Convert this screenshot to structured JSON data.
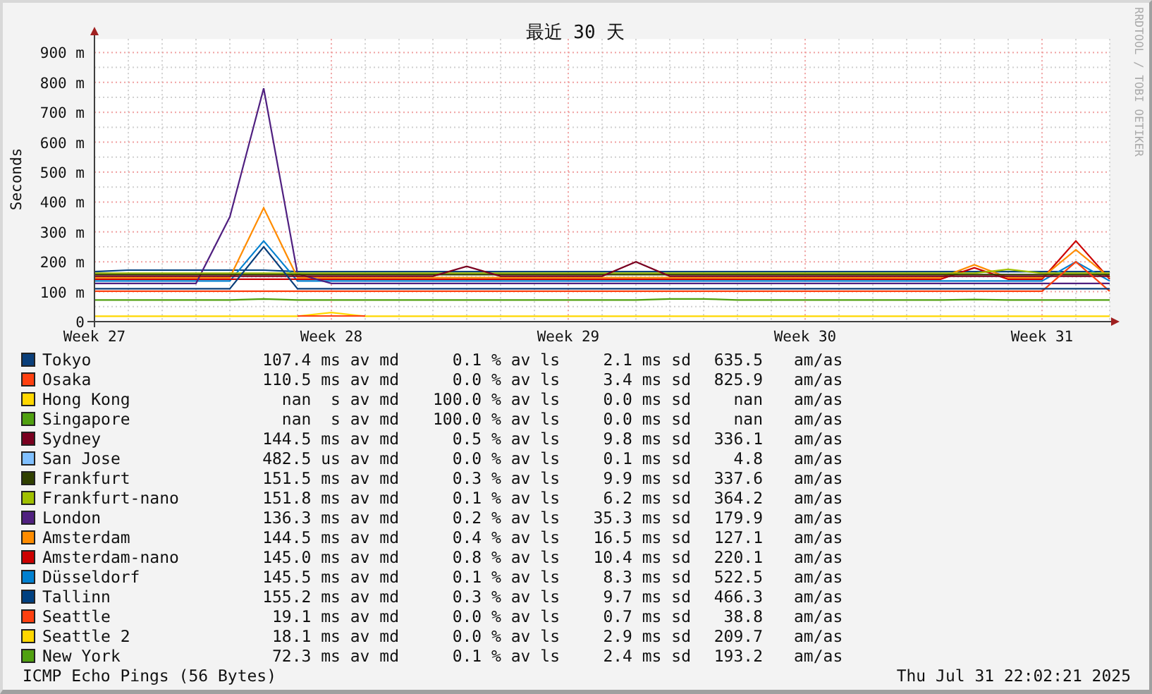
{
  "chart": {
    "vertical_credit": "RRDTOOL / TOBI OETIKER",
    "chart_data": {
      "type": "line",
      "title": "最近 30 天",
      "ylabel": "Seconds",
      "ylim": [
        0,
        945
      ],
      "grid": true,
      "yticks": [
        {
          "value": 0,
          "label": "0"
        },
        {
          "value": 100,
          "label": "100 m"
        },
        {
          "value": 200,
          "label": "200 m"
        },
        {
          "value": 300,
          "label": "300 m"
        },
        {
          "value": 400,
          "label": "400 m"
        },
        {
          "value": 500,
          "label": "500 m"
        },
        {
          "value": 600,
          "label": "600 m"
        },
        {
          "value": 700,
          "label": "700 m"
        },
        {
          "value": 800,
          "label": "800 m"
        },
        {
          "value": 900,
          "label": "900 m"
        }
      ],
      "categories": [
        "Week 27",
        null,
        null,
        null,
        null,
        null,
        null,
        "Week 28",
        null,
        null,
        null,
        null,
        null,
        null,
        "Week 29",
        null,
        null,
        null,
        null,
        null,
        null,
        "Week 30",
        null,
        null,
        null,
        null,
        null,
        null,
        "Week 31",
        null,
        null
      ],
      "series": [
        {
          "name": "Tokyo",
          "color": "#0a3f7a",
          "values": [
            110,
            110,
            110,
            110,
            110,
            250,
            110,
            110,
            110,
            110,
            110,
            110,
            110,
            110,
            110,
            110,
            110,
            110,
            110,
            110,
            110,
            110,
            110,
            110,
            110,
            110,
            110,
            110,
            110,
            110,
            110
          ]
        },
        {
          "name": "Osaka",
          "color": "#ff4010",
          "values": [
            102,
            102,
            102,
            102,
            102,
            102,
            102,
            102,
            102,
            102,
            102,
            102,
            102,
            102,
            102,
            102,
            102,
            102,
            102,
            102,
            102,
            102,
            102,
            102,
            102,
            102,
            102,
            102,
            102,
            200,
            102
          ]
        },
        {
          "name": "Hong Kong",
          "color": "#ffd700",
          "values": [
            null,
            null,
            null,
            null,
            null,
            null,
            null,
            null,
            null,
            null,
            null,
            null,
            null,
            null,
            null,
            null,
            null,
            null,
            null,
            null,
            null,
            null,
            null,
            null,
            null,
            null,
            null,
            null,
            null,
            null,
            null
          ]
        },
        {
          "name": "Singapore",
          "color": "#50a010",
          "values": [
            null,
            null,
            null,
            null,
            null,
            null,
            null,
            null,
            null,
            null,
            null,
            null,
            null,
            null,
            null,
            null,
            null,
            null,
            null,
            null,
            null,
            null,
            null,
            null,
            null,
            null,
            null,
            null,
            null,
            null,
            null
          ]
        },
        {
          "name": "Sydney",
          "color": "#7a0020",
          "values": [
            152,
            152,
            152,
            152,
            152,
            152,
            152,
            152,
            152,
            152,
            152,
            185,
            152,
            152,
            152,
            152,
            200,
            152,
            152,
            152,
            152,
            152,
            152,
            152,
            152,
            152,
            152,
            152,
            152,
            152,
            152
          ]
        },
        {
          "name": "San Jose",
          "color": "#80c0ff",
          "values": [
            null,
            null,
            null,
            null,
            null,
            null,
            null,
            null,
            null,
            null,
            null,
            null,
            null,
            null,
            null,
            null,
            null,
            null,
            null,
            null,
            null,
            null,
            null,
            null,
            null,
            null,
            null,
            null,
            null,
            null,
            null
          ]
        },
        {
          "name": "Frankfurt",
          "color": "#304000",
          "values": [
            157,
            157,
            157,
            157,
            157,
            157,
            157,
            157,
            157,
            157,
            157,
            157,
            157,
            157,
            157,
            157,
            157,
            157,
            157,
            157,
            157,
            157,
            157,
            157,
            157,
            157,
            157,
            157,
            157,
            157,
            157
          ]
        },
        {
          "name": "Frankfurt-nano",
          "color": "#a0c000",
          "values": [
            162,
            162,
            162,
            162,
            162,
            162,
            162,
            162,
            162,
            162,
            162,
            162,
            162,
            162,
            162,
            162,
            162,
            162,
            162,
            162,
            162,
            162,
            162,
            162,
            162,
            162,
            162,
            175,
            162,
            162,
            162
          ]
        },
        {
          "name": "London",
          "color": "#502080",
          "values": [
            128,
            128,
            128,
            128,
            350,
            780,
            160,
            128,
            128,
            128,
            128,
            128,
            128,
            128,
            128,
            128,
            128,
            128,
            128,
            128,
            128,
            128,
            128,
            128,
            128,
            128,
            128,
            128,
            128,
            128,
            128
          ]
        },
        {
          "name": "Amsterdam",
          "color": "#ff8c00",
          "values": [
            147,
            147,
            147,
            147,
            147,
            380,
            147,
            147,
            147,
            147,
            147,
            147,
            147,
            147,
            147,
            147,
            147,
            147,
            147,
            147,
            147,
            147,
            147,
            147,
            147,
            147,
            190,
            147,
            147,
            240,
            147
          ]
        },
        {
          "name": "Amsterdam-nano",
          "color": "#cc0000",
          "values": [
            142,
            142,
            142,
            142,
            142,
            142,
            142,
            142,
            142,
            142,
            142,
            142,
            142,
            142,
            142,
            142,
            142,
            142,
            142,
            142,
            142,
            142,
            142,
            142,
            142,
            142,
            180,
            142,
            142,
            270,
            142
          ]
        },
        {
          "name": "Düsseldorf",
          "color": "#0080d0",
          "values": [
            136,
            136,
            136,
            136,
            136,
            270,
            136,
            136,
            136,
            136,
            136,
            136,
            136,
            136,
            136,
            136,
            136,
            136,
            136,
            136,
            136,
            136,
            136,
            136,
            136,
            136,
            136,
            136,
            136,
            200,
            136
          ]
        },
        {
          "name": "Tallinn",
          "color": "#004080",
          "values": [
            167,
            172,
            172,
            172,
            172,
            172,
            167,
            167,
            167,
            167,
            167,
            167,
            167,
            167,
            167,
            167,
            167,
            167,
            167,
            167,
            167,
            167,
            167,
            167,
            167,
            167,
            167,
            167,
            167,
            167,
            167
          ]
        },
        {
          "name": "Seattle",
          "color": "#ff4010",
          "values": [
            null,
            null,
            null,
            null,
            null,
            null,
            19,
            19,
            19,
            null,
            null,
            null,
            null,
            null,
            null,
            null,
            null,
            null,
            null,
            null,
            null,
            null,
            null,
            null,
            null,
            null,
            null,
            null,
            null,
            null,
            null
          ]
        },
        {
          "name": "Seattle 2",
          "color": "#ffd700",
          "values": [
            18,
            18,
            18,
            18,
            18,
            18,
            18,
            30,
            18,
            18,
            18,
            18,
            18,
            18,
            18,
            18,
            18,
            18,
            18,
            18,
            18,
            18,
            18,
            18,
            18,
            18,
            18,
            18,
            18,
            18,
            18
          ]
        },
        {
          "name": "New York",
          "color": "#50a010",
          "values": [
            72,
            72,
            72,
            72,
            72,
            76,
            72,
            72,
            72,
            72,
            72,
            72,
            72,
            72,
            72,
            72,
            72,
            76,
            76,
            72,
            72,
            72,
            72,
            72,
            72,
            72,
            74,
            72,
            72,
            72,
            72
          ]
        }
      ]
    }
  },
  "legend": [
    {
      "median": "107.4 ms av md",
      "loss": "0.1 % av ls",
      "sd": "2.1 ms sd",
      "ratio": "635.5",
      "unit": "am/as"
    },
    {
      "median": "110.5 ms av md",
      "loss": "0.0 % av ls",
      "sd": "3.4 ms sd",
      "ratio": "825.9",
      "unit": "am/as"
    },
    {
      "median": "nan  s av md",
      "loss": "100.0 % av ls",
      "sd": "0.0 ms sd",
      "ratio": "nan",
      "unit": "am/as"
    },
    {
      "median": "nan  s av md",
      "loss": "100.0 % av ls",
      "sd": "0.0 ms sd",
      "ratio": "nan",
      "unit": "am/as"
    },
    {
      "median": "144.5 ms av md",
      "loss": "0.5 % av ls",
      "sd": "9.8 ms sd",
      "ratio": "336.1",
      "unit": "am/as"
    },
    {
      "median": "482.5 us av md",
      "loss": "0.0 % av ls",
      "sd": "0.1 ms sd",
      "ratio": "4.8",
      "unit": "am/as"
    },
    {
      "median": "151.5 ms av md",
      "loss": "0.3 % av ls",
      "sd": "9.9 ms sd",
      "ratio": "337.6",
      "unit": "am/as"
    },
    {
      "median": "151.8 ms av md",
      "loss": "0.1 % av ls",
      "sd": "6.2 ms sd",
      "ratio": "364.2",
      "unit": "am/as"
    },
    {
      "median": "136.3 ms av md",
      "loss": "0.2 % av ls",
      "sd": "35.3 ms sd",
      "ratio": "179.9",
      "unit": "am/as"
    },
    {
      "median": "144.5 ms av md",
      "loss": "0.4 % av ls",
      "sd": "16.5 ms sd",
      "ratio": "127.1",
      "unit": "am/as"
    },
    {
      "median": "145.0 ms av md",
      "loss": "0.8 % av ls",
      "sd": "10.4 ms sd",
      "ratio": "220.1",
      "unit": "am/as"
    },
    {
      "median": "145.5 ms av md",
      "loss": "0.1 % av ls",
      "sd": "8.3 ms sd",
      "ratio": "522.5",
      "unit": "am/as"
    },
    {
      "median": "155.2 ms av md",
      "loss": "0.3 % av ls",
      "sd": "9.7 ms sd",
      "ratio": "466.3",
      "unit": "am/as"
    },
    {
      "median": "19.1 ms av md",
      "loss": "0.0 % av ls",
      "sd": "0.7 ms sd",
      "ratio": "38.8",
      "unit": "am/as"
    },
    {
      "median": "18.1 ms av md",
      "loss": "0.0 % av ls",
      "sd": "2.9 ms sd",
      "ratio": "209.7",
      "unit": "am/as"
    },
    {
      "median": "72.3 ms av md",
      "loss": "0.1 % av ls",
      "sd": "2.4 ms sd",
      "ratio": "193.2",
      "unit": "am/as"
    }
  ],
  "footer": {
    "description": "ICMP Echo Pings (56 Bytes)",
    "timestamp": "Thu Jul 31 22:02:21 2025"
  }
}
